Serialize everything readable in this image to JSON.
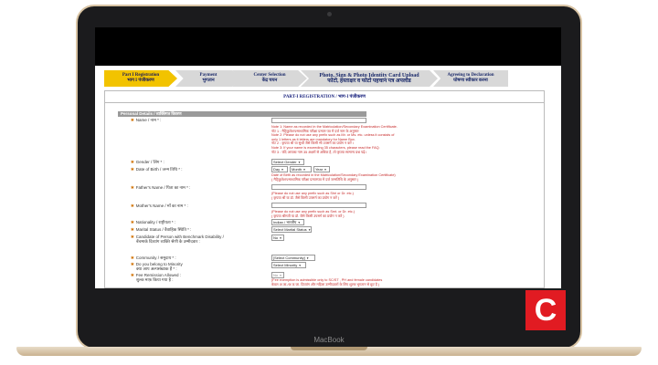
{
  "device": {
    "brand": "MacBook"
  },
  "logo": {
    "letter": "C"
  },
  "steps": [
    {
      "en": "Part I Registration",
      "hi": "भाग I पंजीकरण"
    },
    {
      "en": "Payment",
      "hi": "भुगतान"
    },
    {
      "en": "Center Selection",
      "hi": "केंद्र चयन"
    },
    {
      "en": "Photo, Sign & Photo Identity Card Upload",
      "hi": "फोटो, हस्ताक्षर व फोटो पहचान पत्र अपलोड"
    },
    {
      "en": "Agreeing to Declaration",
      "hi": "घोषणा स्वीकार करना"
    }
  ],
  "form": {
    "heading": "PART-I REGISTRATION / भाग-I पंजीकरण",
    "section": "Personal Details / व्यक्तिगत विवरण",
    "name_label": "Name / नाम * :",
    "name_notes": [
      "Note 1: Name as recorded in the Matriculation/Secondary Examination Certificate.",
      "नोट 1 : मैट्रिकुलेशन/माध्यमिक परीक्षा प्रमाण पत्र में दर्ज नाम के अनुसार",
      "Note 2: Please do not use any prefix such as Mr. or Ms. etc. unless it consists of",
      "only 1 letters as it letters are mandatory for Name Box.",
      "नोट 2 : कृपया श्री या सुश्री जैसे किसी भी उपसर्ग का प्रयोग न करें ।",
      "Note 3: If your name is exceeding 35 characters, please read the FAQ.",
      "नोट 3 : यदि आपका नाम 35 अक्षरों से अधिक है, तो कृपया सामान्य प्रश्न पढ़ें।"
    ],
    "gender_label": "Gender / लिंग * :",
    "gender_value": "Select Gender",
    "dob_label": "Date of Birth / जन्म तिथि * :",
    "dob_day": "Day",
    "dob_month": "Month",
    "dob_year": "Year",
    "dob_notes": [
      "Date of Birth as recorded in the Matriculation/Secondary Examination Certificate)",
      "( मैट्रिकुलेशन/माध्यमिक परीक्षा प्रमाणपत्र में दर्ज जन्मतिथि के अनुसार )"
    ],
    "father_label": "Father's Name / पिता का नाम * :",
    "father_notes": [
      "(Please do not use any prefix such as Shri or Dr. etc.)",
      "( कृपया श्री या डॉ. जैसे किसी उपसर्ग का प्रयोग न करें )"
    ],
    "mother_label": "Mother's Name / माँ का नाम * :",
    "mother_notes": [
      "(Please do not use any prefix such as Smt. or Dr. etc.)",
      "( कृपया श्रीमती या डॉ. जैसे किसी उपसर्ग का प्रयोग न करें )"
    ],
    "nationality_label": "Nationality / राष्ट्रीयता * :",
    "nationality_value": "Indian / भारतीय",
    "marital_label": "Marital Status / वैवाहिक स्थिति * :",
    "marital_value": "Select Marital Status",
    "disability_label_1": "Candidate of Person with Benchmark Disability /",
    "disability_label_2": "बेंचमार्क दिव्यांग व्यक्ति श्रेणी के उम्मीदवार :",
    "disability_value": "No",
    "community_label": "Community / समुदाय * :",
    "community_value": "[Select Community]",
    "minority_label_1": "Do you belong to Minority",
    "minority_label_2": "क्या आप अल्पसंख्यक हैं * :",
    "minority_value": "Select Minority",
    "fee_label_1": "Fee Remission Allowed :",
    "fee_label_2": "शुल्क माफ़ किया गया है :",
    "fee_value": "No",
    "fee_notes": [
      "(Fee exemption is admissible only to SC/ST , PH and female candidates",
      "केवल अ.जा./अ.ज.जा. दिव्यांग और महिला उम्मीदवारों के लिए शुल्क भुगतान से छूट है )"
    ]
  }
}
